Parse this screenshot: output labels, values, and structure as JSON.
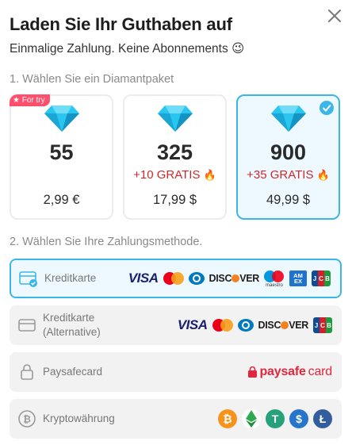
{
  "header": {
    "title": "Laden Sie Ihr Guthaben auf",
    "subtitle": "Einmalige Zahlung. Keine Abonnements 😉"
  },
  "step1": {
    "label": "1. Wählen Sie ein Diamantpaket"
  },
  "packages": [
    {
      "badge": "For try",
      "amount": "55",
      "bonus": "",
      "price": "2,99 €",
      "selected": false
    },
    {
      "badge": "",
      "amount": "325",
      "bonus": "+10 GRATIS",
      "price": "17,99 $",
      "selected": false
    },
    {
      "badge": "",
      "amount": "900",
      "bonus": "+35 GRATIS",
      "price": "49,99 $",
      "selected": true
    }
  ],
  "step2": {
    "label": "2. Wählen Sie Ihre Zahlungsmethode."
  },
  "methods": [
    {
      "label": "Kreditkarte",
      "icon": "credit-card-check-icon",
      "active": true,
      "logos": [
        "VISA",
        "Mastercard",
        "Diners",
        "DISCOVER",
        "maestro",
        "AMEX",
        "JCB"
      ]
    },
    {
      "label": "Kreditkarte",
      "label2": "(Alternative)",
      "icon": "credit-card-icon",
      "active": false,
      "logos": [
        "VISA",
        "Mastercard",
        "Diners",
        "DISCOVER",
        "JCB"
      ]
    },
    {
      "label": "Paysafecard",
      "icon": "lock-icon",
      "active": false,
      "logos": [
        "paysafecard"
      ],
      "brand_left": "paysafe",
      "brand_right": "card"
    },
    {
      "label": "Kryptowährung",
      "icon": "bitcoin-icon",
      "active": false,
      "logos": [
        "bitcoin",
        "ethereum",
        "tether",
        "usd-coin",
        "litecoin"
      ]
    }
  ],
  "logo_text": {
    "visa": "VISA",
    "discover_a": "DISC",
    "discover_b": "VER",
    "maestro": "maestro",
    "amex": "AM EX",
    "jcb_j": "J",
    "jcb_c": "C",
    "jcb_b": "B",
    "btc": "₿",
    "usdt": "T",
    "usdc": "$",
    "ltc": "Ł"
  },
  "colors": {
    "accent": "#3bb6e8",
    "bonus": "#d0282c",
    "badge": "#ff4f6d",
    "paysafecard": "#e2263e"
  }
}
